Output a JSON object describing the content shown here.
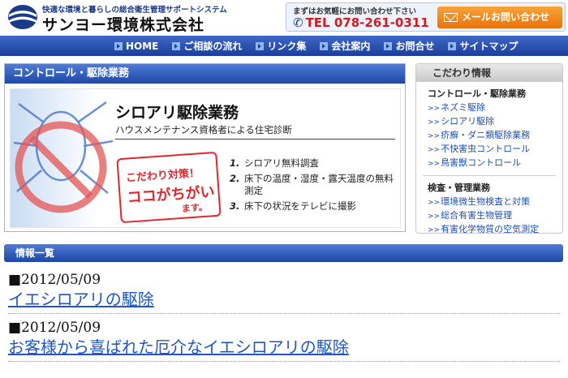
{
  "header": {
    "tagline": "快適な環境と暮らしの総合衛生管理サポートシステム",
    "company_name": "サンヨー環境株式会社",
    "contact_note": "まずはお気軽にお問い合わせ下さい",
    "tel": "TEL 078-261-0311",
    "mail_button": "メールお問い合わせ"
  },
  "nav": {
    "items": [
      {
        "label": "HOME"
      },
      {
        "label": "ご相談の流れ"
      },
      {
        "label": "リンク集"
      },
      {
        "label": "会社案内"
      },
      {
        "label": "お問合せ"
      },
      {
        "label": "サイトマップ"
      }
    ]
  },
  "main": {
    "section_title": "コントロール・駆除業務",
    "banner": {
      "title": "シロアリ駆除業務",
      "subtitle": "ハウスメンテナンス資格者による住宅診断",
      "badge_line1": "こだわり対策！",
      "badge_line2": "ココがちがい",
      "badge_line3": "ます。",
      "features": [
        {
          "num": "1.",
          "text": "シロアリ無料調査"
        },
        {
          "num": "2.",
          "text": "床下の温度・湿度・露天温度の無料測定"
        },
        {
          "num": "3.",
          "text": "床下の状況をテレビに撮影"
        }
      ]
    }
  },
  "sidebar": {
    "title": "こだわり情報",
    "groups": [
      {
        "category": "コントロール・駆除業務",
        "links": [
          "ネズミ駆除",
          "シロアリ駆除",
          "疥癬・ダニ類駆除業務",
          "不快害虫コントロール",
          "鳥害獣コントロール"
        ]
      },
      {
        "category": "検査・管理業務",
        "links": [
          "環境微生物検査と対策",
          "総合有害生物管理",
          "有害化学物質の空気測定"
        ]
      }
    ],
    "link_arrow": ">>"
  },
  "info": {
    "title": "情報一覧",
    "items": [
      {
        "date": "■2012/05/09",
        "title": "イエシロアリの駆除"
      },
      {
        "date": "■2012/05/09",
        "title": "お客様から喜ばれた厄介なイエシロアリの駆除"
      }
    ]
  }
}
